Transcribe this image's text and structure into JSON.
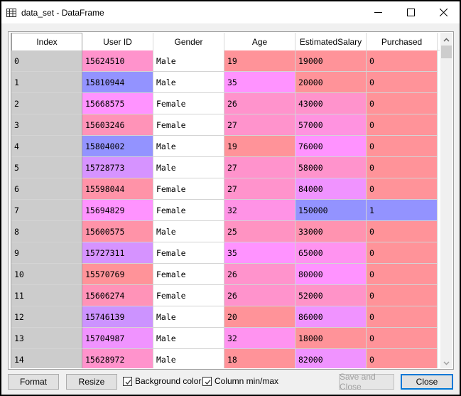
{
  "window": {
    "title": "data_set - DataFrame",
    "icon": "table-grid-icon",
    "controls": [
      "minimize-icon",
      "maximize-icon",
      "close-icon"
    ]
  },
  "table": {
    "columns": [
      "Index",
      "User ID",
      "Gender",
      "Age",
      "EstimatedSalary",
      "Purchased"
    ],
    "rows": [
      {
        "index": "0",
        "user_id": "15624510",
        "gender": "Male",
        "age": "19",
        "salary": "19000",
        "purchased": "0"
      },
      {
        "index": "1",
        "user_id": "15810944",
        "gender": "Male",
        "age": "35",
        "salary": "20000",
        "purchased": "0"
      },
      {
        "index": "2",
        "user_id": "15668575",
        "gender": "Female",
        "age": "26",
        "salary": "43000",
        "purchased": "0"
      },
      {
        "index": "3",
        "user_id": "15603246",
        "gender": "Female",
        "age": "27",
        "salary": "57000",
        "purchased": "0"
      },
      {
        "index": "4",
        "user_id": "15804002",
        "gender": "Male",
        "age": "19",
        "salary": "76000",
        "purchased": "0"
      },
      {
        "index": "5",
        "user_id": "15728773",
        "gender": "Male",
        "age": "27",
        "salary": "58000",
        "purchased": "0"
      },
      {
        "index": "6",
        "user_id": "15598044",
        "gender": "Female",
        "age": "27",
        "salary": "84000",
        "purchased": "0"
      },
      {
        "index": "7",
        "user_id": "15694829",
        "gender": "Female",
        "age": "32",
        "salary": "150000",
        "purchased": "1"
      },
      {
        "index": "8",
        "user_id": "15600575",
        "gender": "Male",
        "age": "25",
        "salary": "33000",
        "purchased": "0"
      },
      {
        "index": "9",
        "user_id": "15727311",
        "gender": "Female",
        "age": "35",
        "salary": "65000",
        "purchased": "0"
      },
      {
        "index": "10",
        "user_id": "15570769",
        "gender": "Female",
        "age": "26",
        "salary": "80000",
        "purchased": "0"
      },
      {
        "index": "11",
        "user_id": "15606274",
        "gender": "Female",
        "age": "26",
        "salary": "52000",
        "purchased": "0"
      },
      {
        "index": "12",
        "user_id": "15746139",
        "gender": "Male",
        "age": "20",
        "salary": "86000",
        "purchased": "0"
      },
      {
        "index": "13",
        "user_id": "15704987",
        "gender": "Male",
        "age": "32",
        "salary": "18000",
        "purchased": "0"
      },
      {
        "index": "14",
        "user_id": "15628972",
        "gender": "Male",
        "age": "18",
        "salary": "82000",
        "purchased": "0"
      }
    ],
    "cell_colors": [
      [
        "#ff93cc",
        "#ff9399",
        "#ff9399",
        "#ff9399"
      ],
      [
        "#9393ff",
        "#ff93ff",
        "#ff9399",
        "#ff9399"
      ],
      [
        "#ff93ff",
        "#ff93cc",
        "#ff93cc",
        "#ff9399"
      ],
      [
        "#ff93b8",
        "#ff93cc",
        "#ff93e0",
        "#ff9399"
      ],
      [
        "#9393ff",
        "#ff9399",
        "#ff93ff",
        "#ff9399"
      ],
      [
        "#d693ff",
        "#ff93cc",
        "#ff93cc",
        "#ff9399"
      ],
      [
        "#ff93a8",
        "#ff93cc",
        "#f093ff",
        "#ff9399"
      ],
      [
        "#ff93ff",
        "#ff93e6",
        "#9393ff",
        "#9393ff"
      ],
      [
        "#ff93a8",
        "#ff93c2",
        "#ff93b0",
        "#ff9399"
      ],
      [
        "#d693ff",
        "#ff93ff",
        "#ff93f0",
        "#ff9399"
      ],
      [
        "#ff9399",
        "#ff93cc",
        "#ff93ff",
        "#ff9399"
      ],
      [
        "#ff93b8",
        "#ff93cc",
        "#ff93c8",
        "#ff9399"
      ],
      [
        "#cc93ff",
        "#ff9399",
        "#f093ff",
        "#ff9399"
      ],
      [
        "#f093ff",
        "#ff93f0",
        "#ff9399",
        "#ff9399"
      ],
      [
        "#ff93cc",
        "#ff9399",
        "#f093ff",
        "#ff9399"
      ]
    ],
    "gender_bg": "#ffffff",
    "index_bg": "#cccccc"
  },
  "buttons": {
    "format": "Format",
    "resize": "Resize",
    "background_color": "Background color",
    "background_color_checked": true,
    "column_minmax": "Column min/max",
    "column_minmax_checked": true,
    "save_and_close": "Save and Close",
    "close": "Close"
  }
}
